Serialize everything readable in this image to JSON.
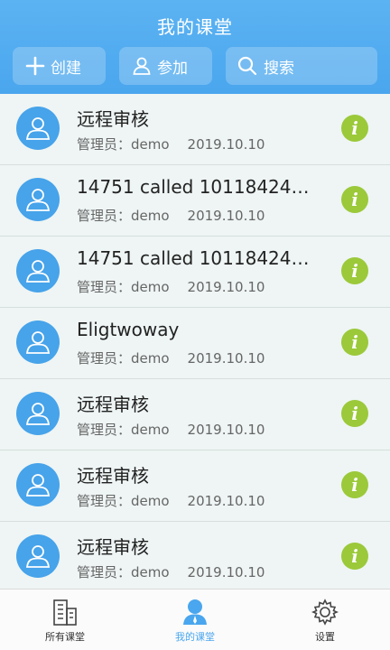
{
  "header": {
    "title": "我的课堂",
    "actions": {
      "create_label": "创建",
      "join_label": "参加",
      "search_label": "搜索"
    }
  },
  "classes": [
    {
      "title": "远程审核",
      "admin": "管理员：demo",
      "date": "2019.10.10"
    },
    {
      "title": "14751 called 1011842422…",
      "admin": "管理员：demo",
      "date": "2019.10.10"
    },
    {
      "title": "14751 called 1011842422…",
      "admin": "管理员：demo",
      "date": "2019.10.10"
    },
    {
      "title": "Eligtwoway",
      "admin": "管理员：demo",
      "date": "2019.10.10"
    },
    {
      "title": "远程审核",
      "admin": "管理员：demo",
      "date": "2019.10.10"
    },
    {
      "title": "远程审核",
      "admin": "管理员：demo",
      "date": "2019.10.10"
    },
    {
      "title": "远程审核",
      "admin": "管理员：demo",
      "date": "2019.10.10"
    }
  ],
  "info_glyph": "i",
  "tabbar": {
    "tabs": [
      {
        "label": "所有课堂",
        "icon": "building-icon",
        "active": false
      },
      {
        "label": "我的课堂",
        "icon": "user-icon",
        "active": true
      },
      {
        "label": "设置",
        "icon": "gear-icon",
        "active": false
      }
    ]
  },
  "colors": {
    "header": "#4aa6ee",
    "avatar": "#47a3ea",
    "info": "#9bc93a",
    "active_tab": "#4aa6ee"
  }
}
